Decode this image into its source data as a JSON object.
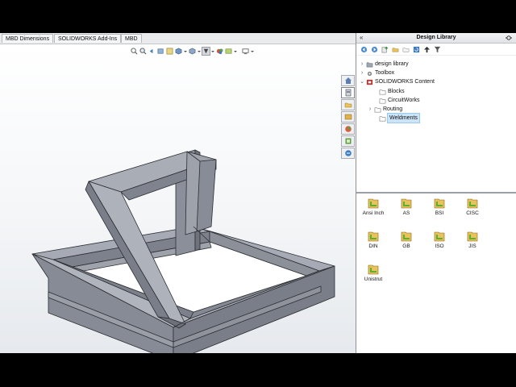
{
  "command_tabs": [
    {
      "label": "MBD Dimensions"
    },
    {
      "label": "SOLIDWORKS Add-Ins"
    },
    {
      "label": "MBD"
    }
  ],
  "heads_up_icons": [
    "zoom-to-fit-icon",
    "zoom-area-icon",
    "previous-view-icon",
    "section-view-icon",
    "dynamic-annotation-icon",
    "view-orientation-icon",
    "display-style-icon",
    "hide-show-items-icon",
    "edit-appearance-icon",
    "apply-scene-icon",
    "view-settings-icon"
  ],
  "task_pane_tabs": [
    "solidworks-resources-icon",
    "design-library-icon",
    "file-explorer-icon",
    "view-palette-icon",
    "appearances-icon",
    "custom-properties-icon",
    "solidworks-forum-icon"
  ],
  "panel": {
    "title": "Design Library",
    "collapse_glyph": "«",
    "toolbar_icons": [
      "back-icon",
      "forward-icon",
      "add-to-library-icon",
      "add-file-location-icon",
      "create-new-folder-icon",
      "refresh-icon",
      "up-one-level-icon",
      "filter-icon"
    ]
  },
  "tree": [
    {
      "label": "design library",
      "expander": ">",
      "icon": "library-folder-icon",
      "selected": false
    },
    {
      "label": "Toolbox",
      "expander": ">",
      "icon": "toolbox-icon",
      "selected": false
    },
    {
      "label": "SOLIDWORKS Content",
      "expander": "v",
      "icon": "solidworks-content-icon",
      "selected": false
    },
    {
      "label": "Blocks",
      "expander": "",
      "icon": "folder-icon",
      "selected": false
    },
    {
      "label": "CircuitWorks",
      "expander": "",
      "icon": "folder-icon",
      "selected": false
    },
    {
      "label": "Routing",
      "expander": ">",
      "icon": "folder-icon",
      "selected": false
    },
    {
      "label": "Weldments",
      "expander": "",
      "icon": "folder-icon",
      "selected": true
    }
  ],
  "standards": [
    {
      "label": "Ansi Inch"
    },
    {
      "label": "AS"
    },
    {
      "label": "BSI"
    },
    {
      "label": "CISC"
    },
    {
      "label": "DIN"
    },
    {
      "label": "GB"
    },
    {
      "label": "ISO"
    },
    {
      "label": "JIS"
    },
    {
      "label": "Unistrut"
    }
  ],
  "colors": {
    "model_top": "#a6aab4",
    "model_side": "#878b95",
    "model_dark": "#6e727b",
    "model_edge": "#2c2e33",
    "selection": "#cce4f7",
    "folder_icon": "#e8c25a",
    "weldment_icon_green": "#5bb030"
  }
}
